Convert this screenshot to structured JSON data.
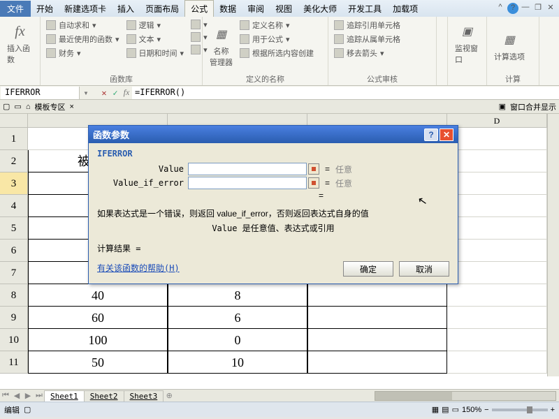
{
  "tabs": {
    "file": "文件",
    "t1": "开始",
    "t2": "新建选项卡",
    "t3": "插入",
    "t4": "页面布局",
    "t5": "公式",
    "t6": "数据",
    "t7": "审阅",
    "t8": "视图",
    "t9": "美化大师",
    "t10": "开发工具",
    "t11": "加载项"
  },
  "ribbon": {
    "insert_fn": "插入函数",
    "autosum": "自动求和",
    "recent": "最近使用的函数",
    "financial": "财务",
    "logical": "逻辑",
    "text": "文本",
    "datetime": "日期和时间",
    "name_mgr": "名称\n管理器",
    "define": "定义名称",
    "use_formula": "用于公式",
    "from_sel": "根据所选内容创建",
    "trace_prec": "追踪引用单元格",
    "trace_dep": "追踪从属单元格",
    "remove_arrows": "移去箭头",
    "watch": "监视窗口",
    "calc_opt": "计算选项",
    "g1": "函数库",
    "g2": "定义的名称",
    "g3": "公式审核",
    "g4": "计算"
  },
  "name_box": "IFERROR",
  "formula": "=IFERROR()",
  "template_label": "模板专区",
  "window_all": "窗口合并显示",
  "cols": {
    "D": "D"
  },
  "rows": [
    "1",
    "2",
    "3",
    "4",
    "5",
    "6",
    "7",
    "8",
    "9",
    "10",
    "11"
  ],
  "cell_b2": "被",
  "table": {
    "r8": {
      "a": "40",
      "b": "8"
    },
    "r9": {
      "a": "60",
      "b": "6"
    },
    "r10": {
      "a": "100",
      "b": "0"
    },
    "r11": {
      "a": "50",
      "b": "10"
    }
  },
  "sheets": {
    "s1": "Sheet1",
    "s2": "Sheet2",
    "s3": "Sheet3"
  },
  "status": {
    "edit": "编辑",
    "zoom": "150%"
  },
  "dialog": {
    "title": "函数参数",
    "func": "IFERROR",
    "arg1": "Value",
    "arg2": "Value_if_error",
    "hint": "任意",
    "eq": "=",
    "desc": "如果表达式是一个错误，则返回 value_if_error，否则返回表达式自身的值",
    "desc2": "Value  是任意值、表达式或引用",
    "result": "计算结果 =",
    "help": "有关该函数的帮助(H)",
    "ok": "确定",
    "cancel": "取消"
  }
}
